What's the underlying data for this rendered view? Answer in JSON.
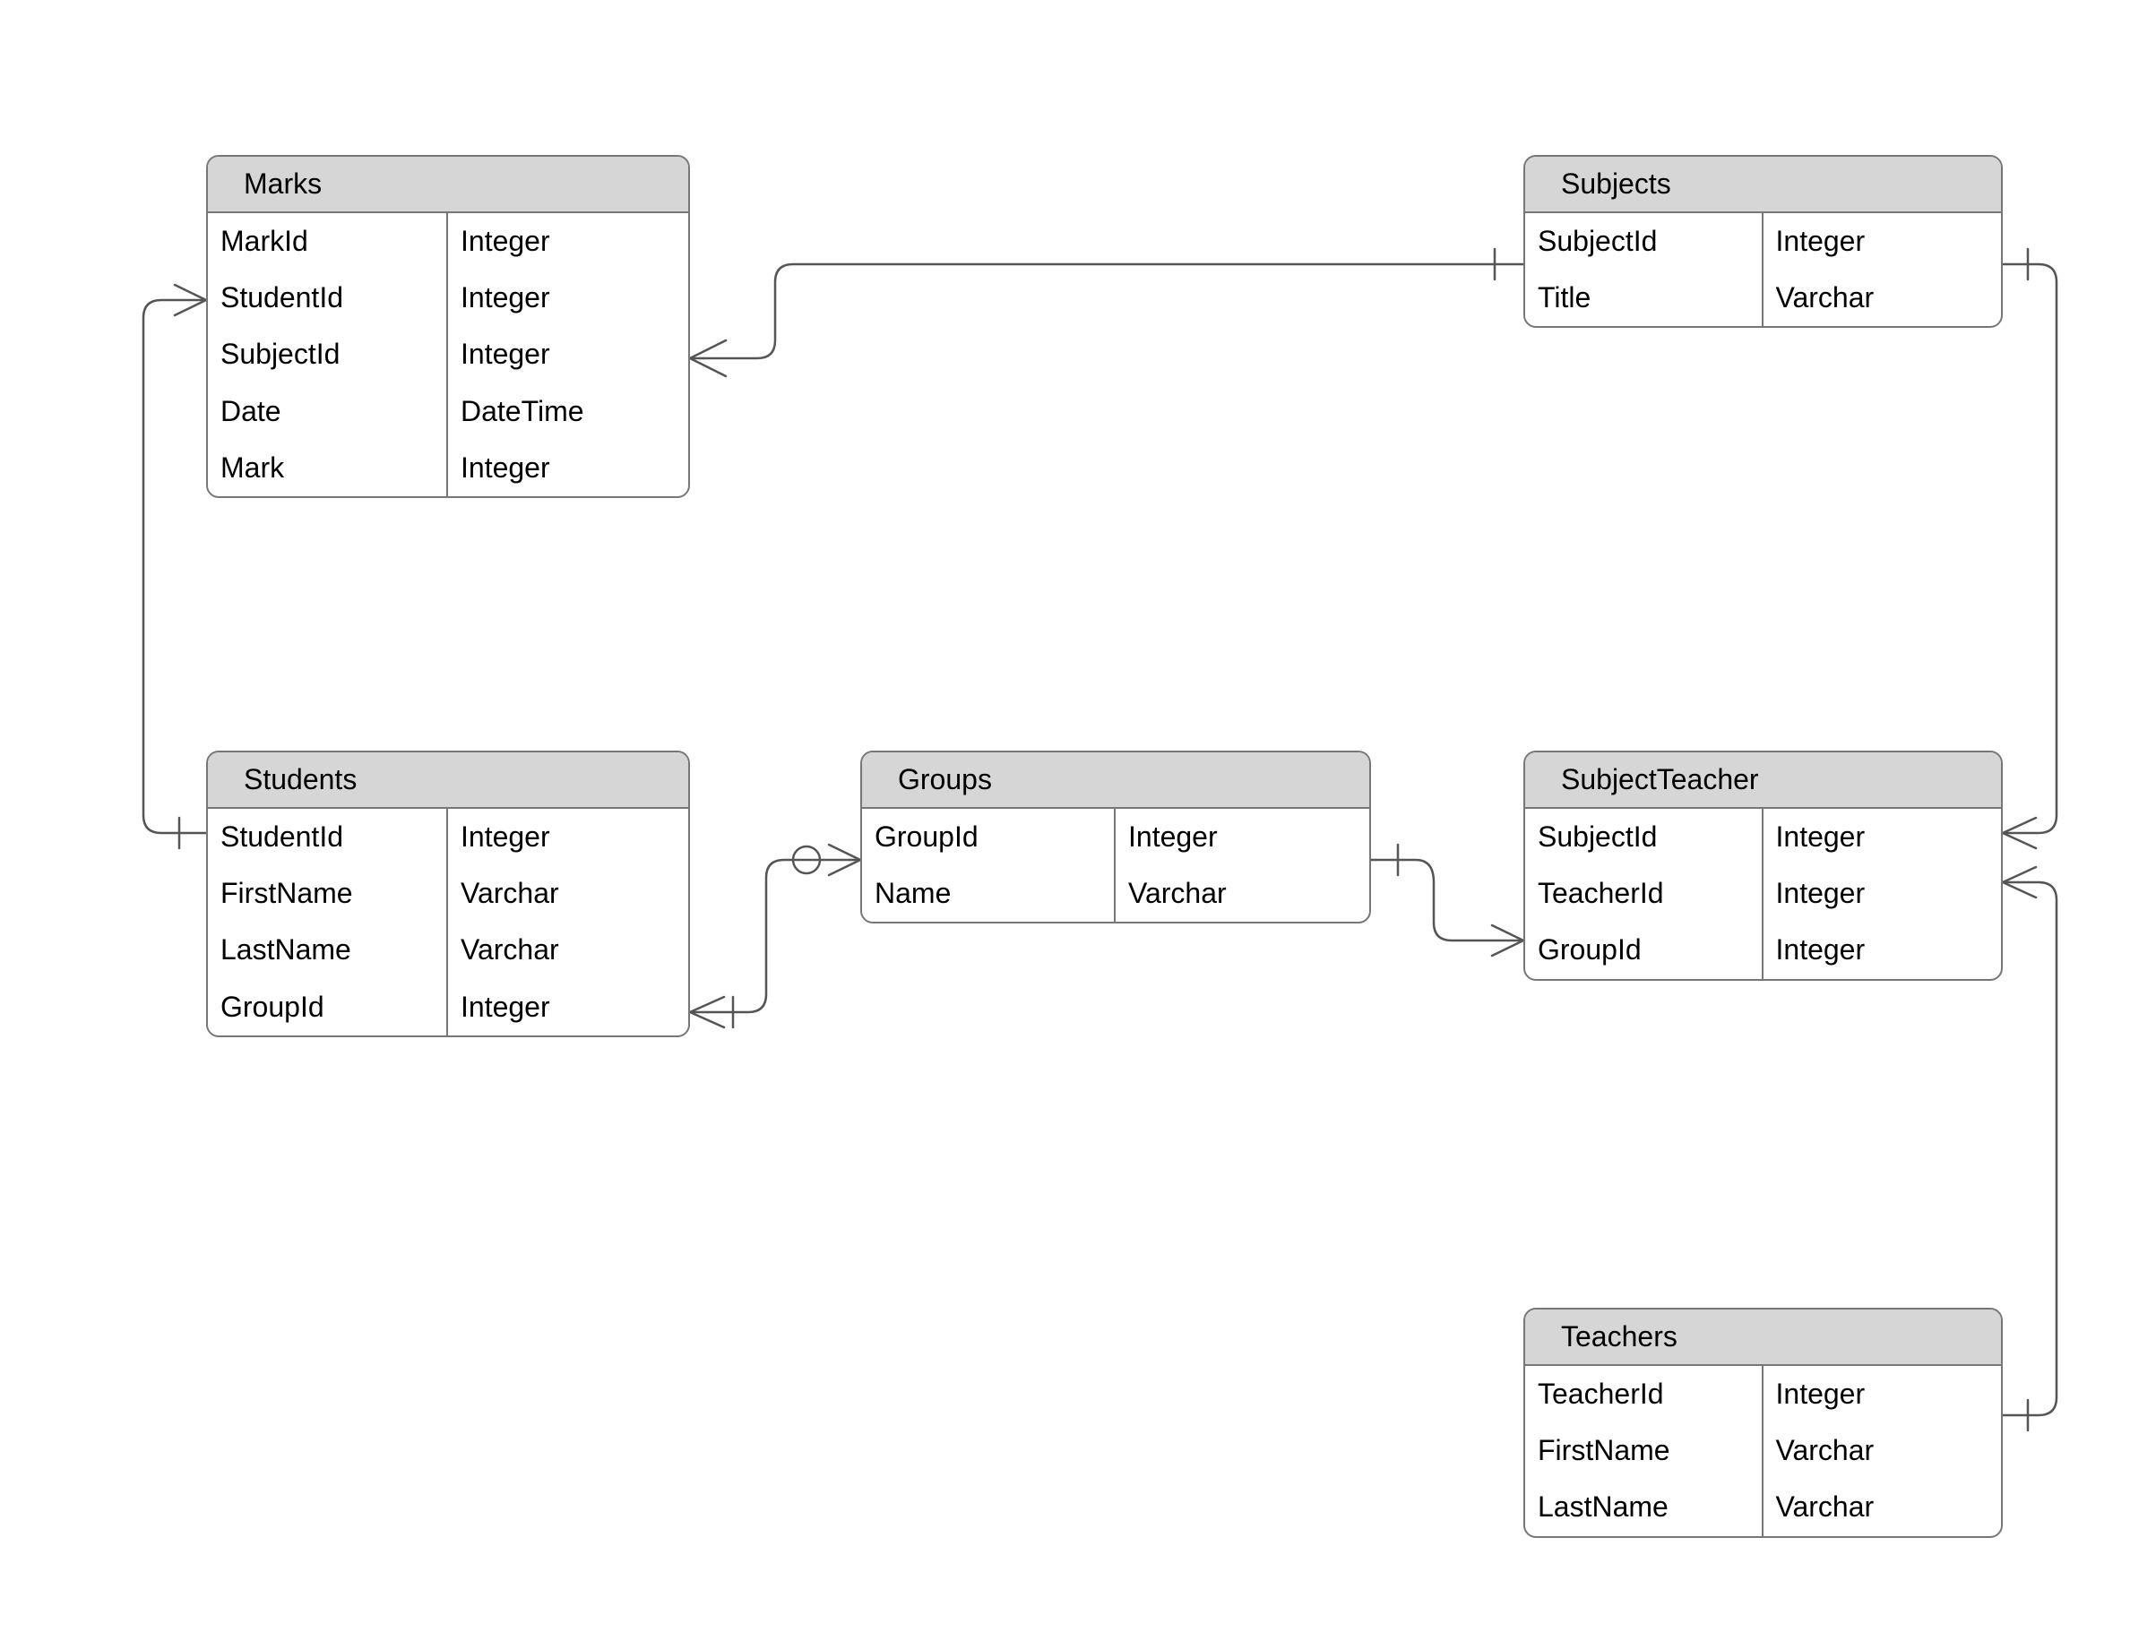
{
  "diagram_type": "entity-relationship",
  "entities": {
    "marks": {
      "title": "Marks",
      "fields": [
        {
          "name": "MarkId",
          "type": "Integer"
        },
        {
          "name": "StudentId",
          "type": "Integer"
        },
        {
          "name": "SubjectId",
          "type": "Integer"
        },
        {
          "name": "Date",
          "type": "DateTime"
        },
        {
          "name": "Mark",
          "type": "Integer"
        }
      ]
    },
    "subjects": {
      "title": "Subjects",
      "fields": [
        {
          "name": "SubjectId",
          "type": "Integer"
        },
        {
          "name": "Title",
          "type": "Varchar"
        }
      ]
    },
    "students": {
      "title": "Students",
      "fields": [
        {
          "name": "StudentId",
          "type": "Integer"
        },
        {
          "name": "FirstName",
          "type": "Varchar"
        },
        {
          "name": "LastName",
          "type": "Varchar"
        },
        {
          "name": "GroupId",
          "type": "Integer"
        }
      ]
    },
    "groups": {
      "title": "Groups",
      "fields": [
        {
          "name": "GroupId",
          "type": "Integer"
        },
        {
          "name": "Name",
          "type": "Varchar"
        }
      ]
    },
    "subjectteacher": {
      "title": "SubjectTeacher",
      "fields": [
        {
          "name": "SubjectId",
          "type": "Integer"
        },
        {
          "name": "TeacherId",
          "type": "Integer"
        },
        {
          "name": "GroupId",
          "type": "Integer"
        }
      ]
    },
    "teachers": {
      "title": "Teachers",
      "fields": [
        {
          "name": "TeacherId",
          "type": "Integer"
        },
        {
          "name": "FirstName",
          "type": "Varchar"
        },
        {
          "name": "LastName",
          "type": "Varchar"
        }
      ]
    }
  },
  "relationships": [
    {
      "from": "Marks",
      "to": "Subjects",
      "from_card": "many",
      "to_card": "one"
    },
    {
      "from": "Marks",
      "to": "Students",
      "from_card": "many",
      "to_card": "one"
    },
    {
      "from": "Students",
      "to": "Groups",
      "from_card": "one-or-many",
      "to_card": "zero-or-one"
    },
    {
      "from": "SubjectTeacher",
      "to": "Groups",
      "from_card": "many",
      "to_card": "one"
    },
    {
      "from": "SubjectTeacher",
      "to": "Subjects",
      "from_card": "many",
      "to_card": "one"
    },
    {
      "from": "SubjectTeacher",
      "to": "Teachers",
      "from_card": "many",
      "to_card": "one"
    }
  ]
}
